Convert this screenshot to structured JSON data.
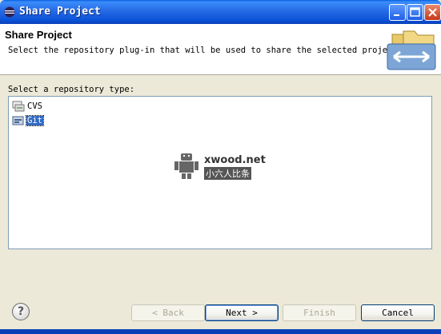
{
  "window": {
    "title": "Share Project",
    "controls": [
      "minimize",
      "maximize",
      "close"
    ]
  },
  "banner": {
    "heading": "Share Project",
    "description": "Select the repository plug-in that will be used to share the selected project.",
    "icon": "share-project-wizard-icon"
  },
  "repository": {
    "label": "Select a repository type:",
    "types": [
      {
        "label": "CVS",
        "icon": "cvs-icon",
        "selected": false
      },
      {
        "label": "Git",
        "icon": "git-icon",
        "selected": true
      }
    ]
  },
  "watermark": {
    "brand": "xwood.net",
    "tag": "小六人比条"
  },
  "buttons": {
    "help": "?",
    "back": "< Back",
    "next": "Next >",
    "finish": "Finish",
    "cancel": "Cancel"
  },
  "colors": {
    "titlebar": "#0a52d6",
    "selection": "#316ac5",
    "dialog_bg": "#ece9d8"
  }
}
